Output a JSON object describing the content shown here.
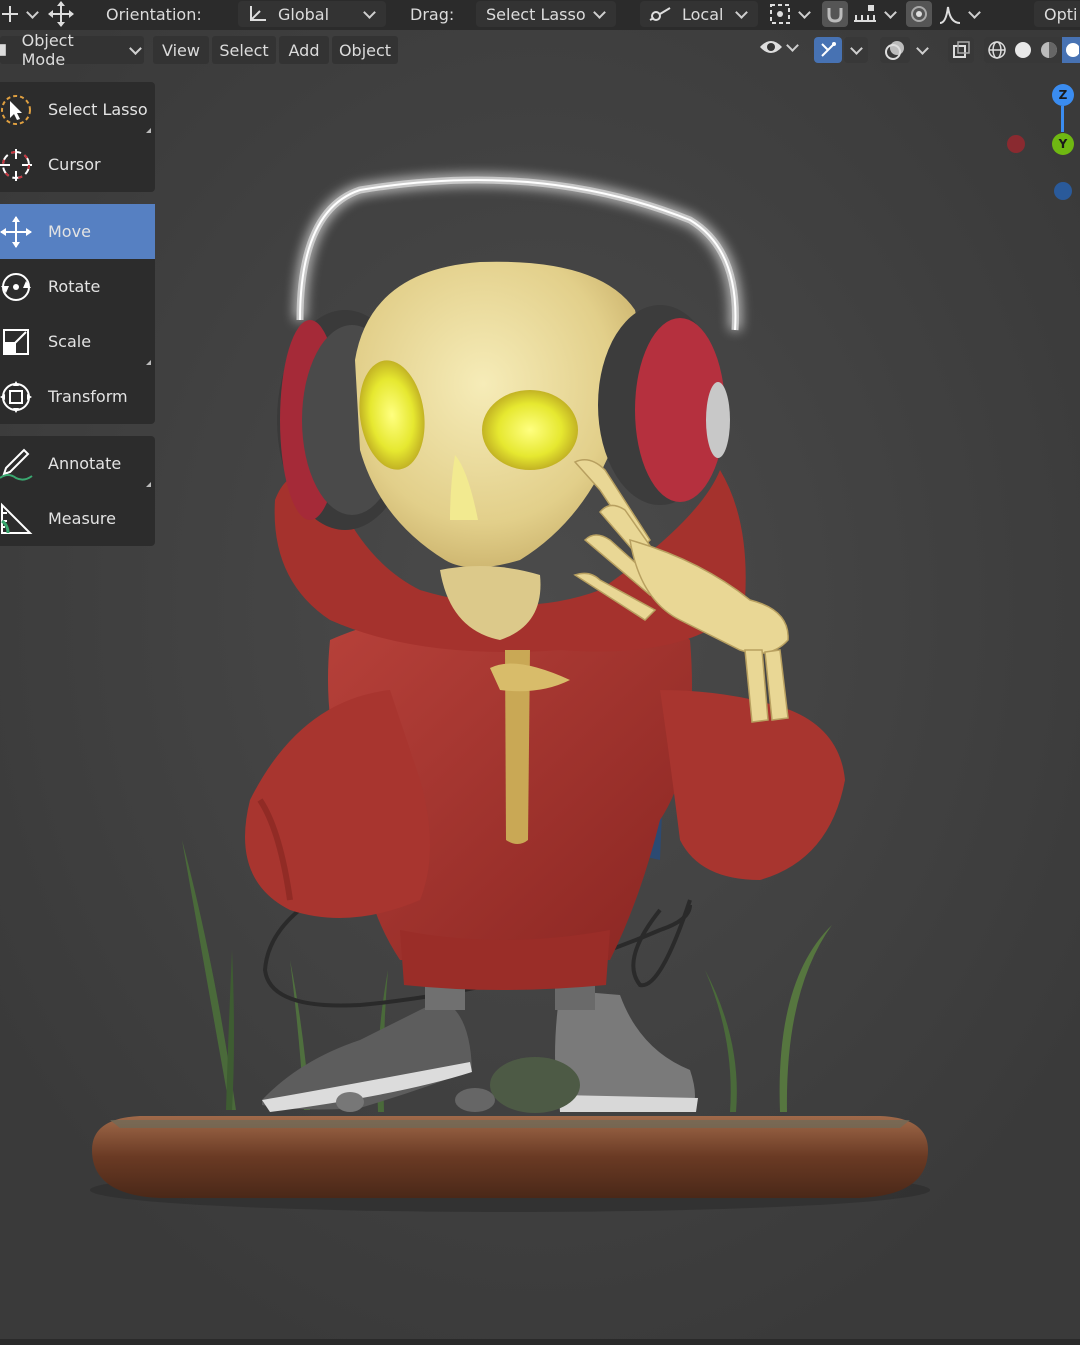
{
  "header": {
    "orientation_label": "Orientation:",
    "orientation_value": "Global",
    "drag_label": "Drag:",
    "drag_value": "Select Lasso",
    "pivot_value": "Local",
    "options_label": "Opti"
  },
  "menubar": {
    "mode": "Object Mode",
    "items": [
      "View",
      "Select",
      "Add",
      "Object"
    ]
  },
  "toolbar": {
    "tools": [
      {
        "label": "Select Lasso",
        "icon": "lasso-select-icon"
      },
      {
        "label": "Cursor",
        "icon": "cursor-icon"
      },
      {
        "label": "Move",
        "icon": "move-icon",
        "active": true
      },
      {
        "label": "Rotate",
        "icon": "rotate-icon"
      },
      {
        "label": "Scale",
        "icon": "scale-icon"
      },
      {
        "label": "Transform",
        "icon": "transform-icon"
      },
      {
        "label": "Annotate",
        "icon": "annotate-icon"
      },
      {
        "label": "Measure",
        "icon": "measure-icon"
      }
    ]
  },
  "gizmo": {
    "z": "Z",
    "y": "Y"
  },
  "colors": {
    "active_tool": "#5680c2",
    "axis_x": "#c8323c",
    "axis_y": "#6fb812",
    "axis_z": "#3a8cf0",
    "hoodie": "#a3302c",
    "bone": "#e9dca0",
    "eye_glow": "#e8e83a"
  }
}
